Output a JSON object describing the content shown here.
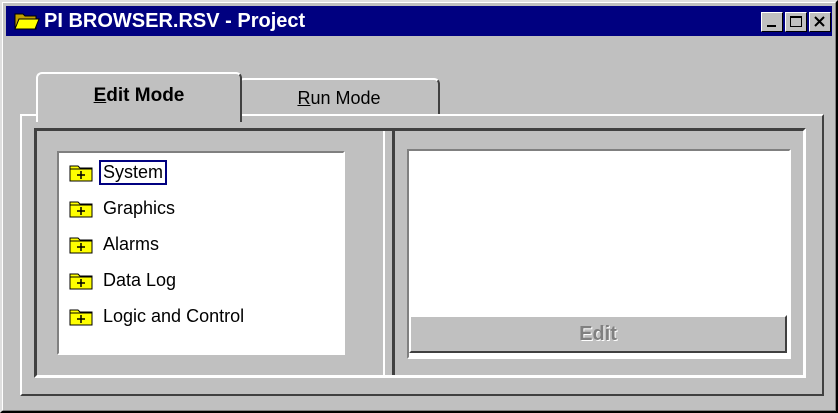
{
  "window": {
    "title": "PI BROWSER.RSV - Project"
  },
  "tabs": [
    {
      "label_pre": "",
      "label_ul": "E",
      "label_post": "dit Mode",
      "selected": true
    },
    {
      "label_pre": "",
      "label_ul": "R",
      "label_post": "un Mode",
      "selected": false
    }
  ],
  "tree": {
    "items": [
      {
        "label": "System",
        "focused": true
      },
      {
        "label": "Graphics"
      },
      {
        "label": "Alarms"
      },
      {
        "label": "Data Log"
      },
      {
        "label": "Logic and Control"
      }
    ]
  },
  "actions": {
    "edit_label": "Edit",
    "edit_enabled": false
  },
  "icons": {
    "app": "folder-open-icon",
    "tree_node": "folder-expand-icon"
  },
  "colors": {
    "titlebar": "#000080",
    "face": "#c0c0c0",
    "folder": "#ffff00"
  }
}
